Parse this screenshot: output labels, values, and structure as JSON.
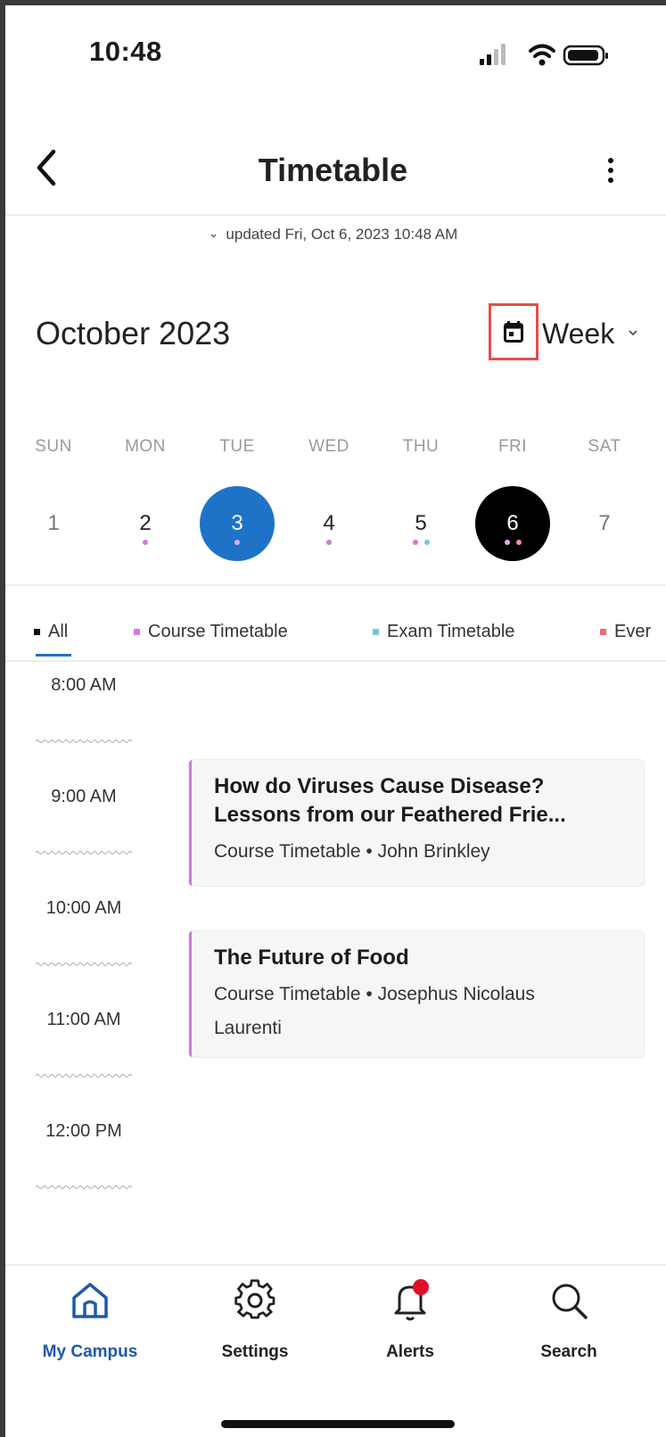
{
  "status_bar": {
    "time": "10:48"
  },
  "header": {
    "title": "Timetable",
    "updated_text": "updated Fri, Oct 6, 2023 10:48 AM"
  },
  "calendar": {
    "month_label": "October 2023",
    "view_mode": "Week",
    "days_of_week": [
      "SUN",
      "MON",
      "TUE",
      "WED",
      "THU",
      "FRI",
      "SAT"
    ],
    "dates": [
      "1",
      "2",
      "3",
      "4",
      "5",
      "6",
      "7"
    ],
    "today_date": "3",
    "selected_date": "6"
  },
  "filters": [
    {
      "label": "All",
      "color": "#111111",
      "active": true
    },
    {
      "label": "Course Timetable",
      "color": "#d07ad8"
    },
    {
      "label": "Exam Timetable",
      "color": "#7cc7c9"
    },
    {
      "label": "Ever",
      "color": "#ef6b7a"
    }
  ],
  "time_slots": [
    "8:00 AM",
    "9:00 AM",
    "10:00 AM",
    "11:00 AM",
    "12:00 PM"
  ],
  "events": [
    {
      "title_line1": "How do Viruses Cause Disease?",
      "title_line2": "Lessons from our Feathered Frie...",
      "subtitle": "Course Timetable • John Brinkley"
    },
    {
      "title_line1": "The Future of Food",
      "subtitle_line1": "Course Timetable • Josephus Nicolaus",
      "subtitle_line2": "Laurenti"
    }
  ],
  "bottom_nav": [
    {
      "label": "My Campus",
      "icon": "home-icon",
      "active": true
    },
    {
      "label": "Settings",
      "icon": "gear-icon"
    },
    {
      "label": "Alerts",
      "icon": "bell-icon",
      "badge": true
    },
    {
      "label": "Search",
      "icon": "search-icon"
    }
  ],
  "colors": {
    "accent": "#1e73c9",
    "course": "#d07ad8",
    "exam": "#7cc7c9",
    "event": "#ef6b7a",
    "badge": "#e0102a",
    "highlight_box": "#e74c4c"
  }
}
